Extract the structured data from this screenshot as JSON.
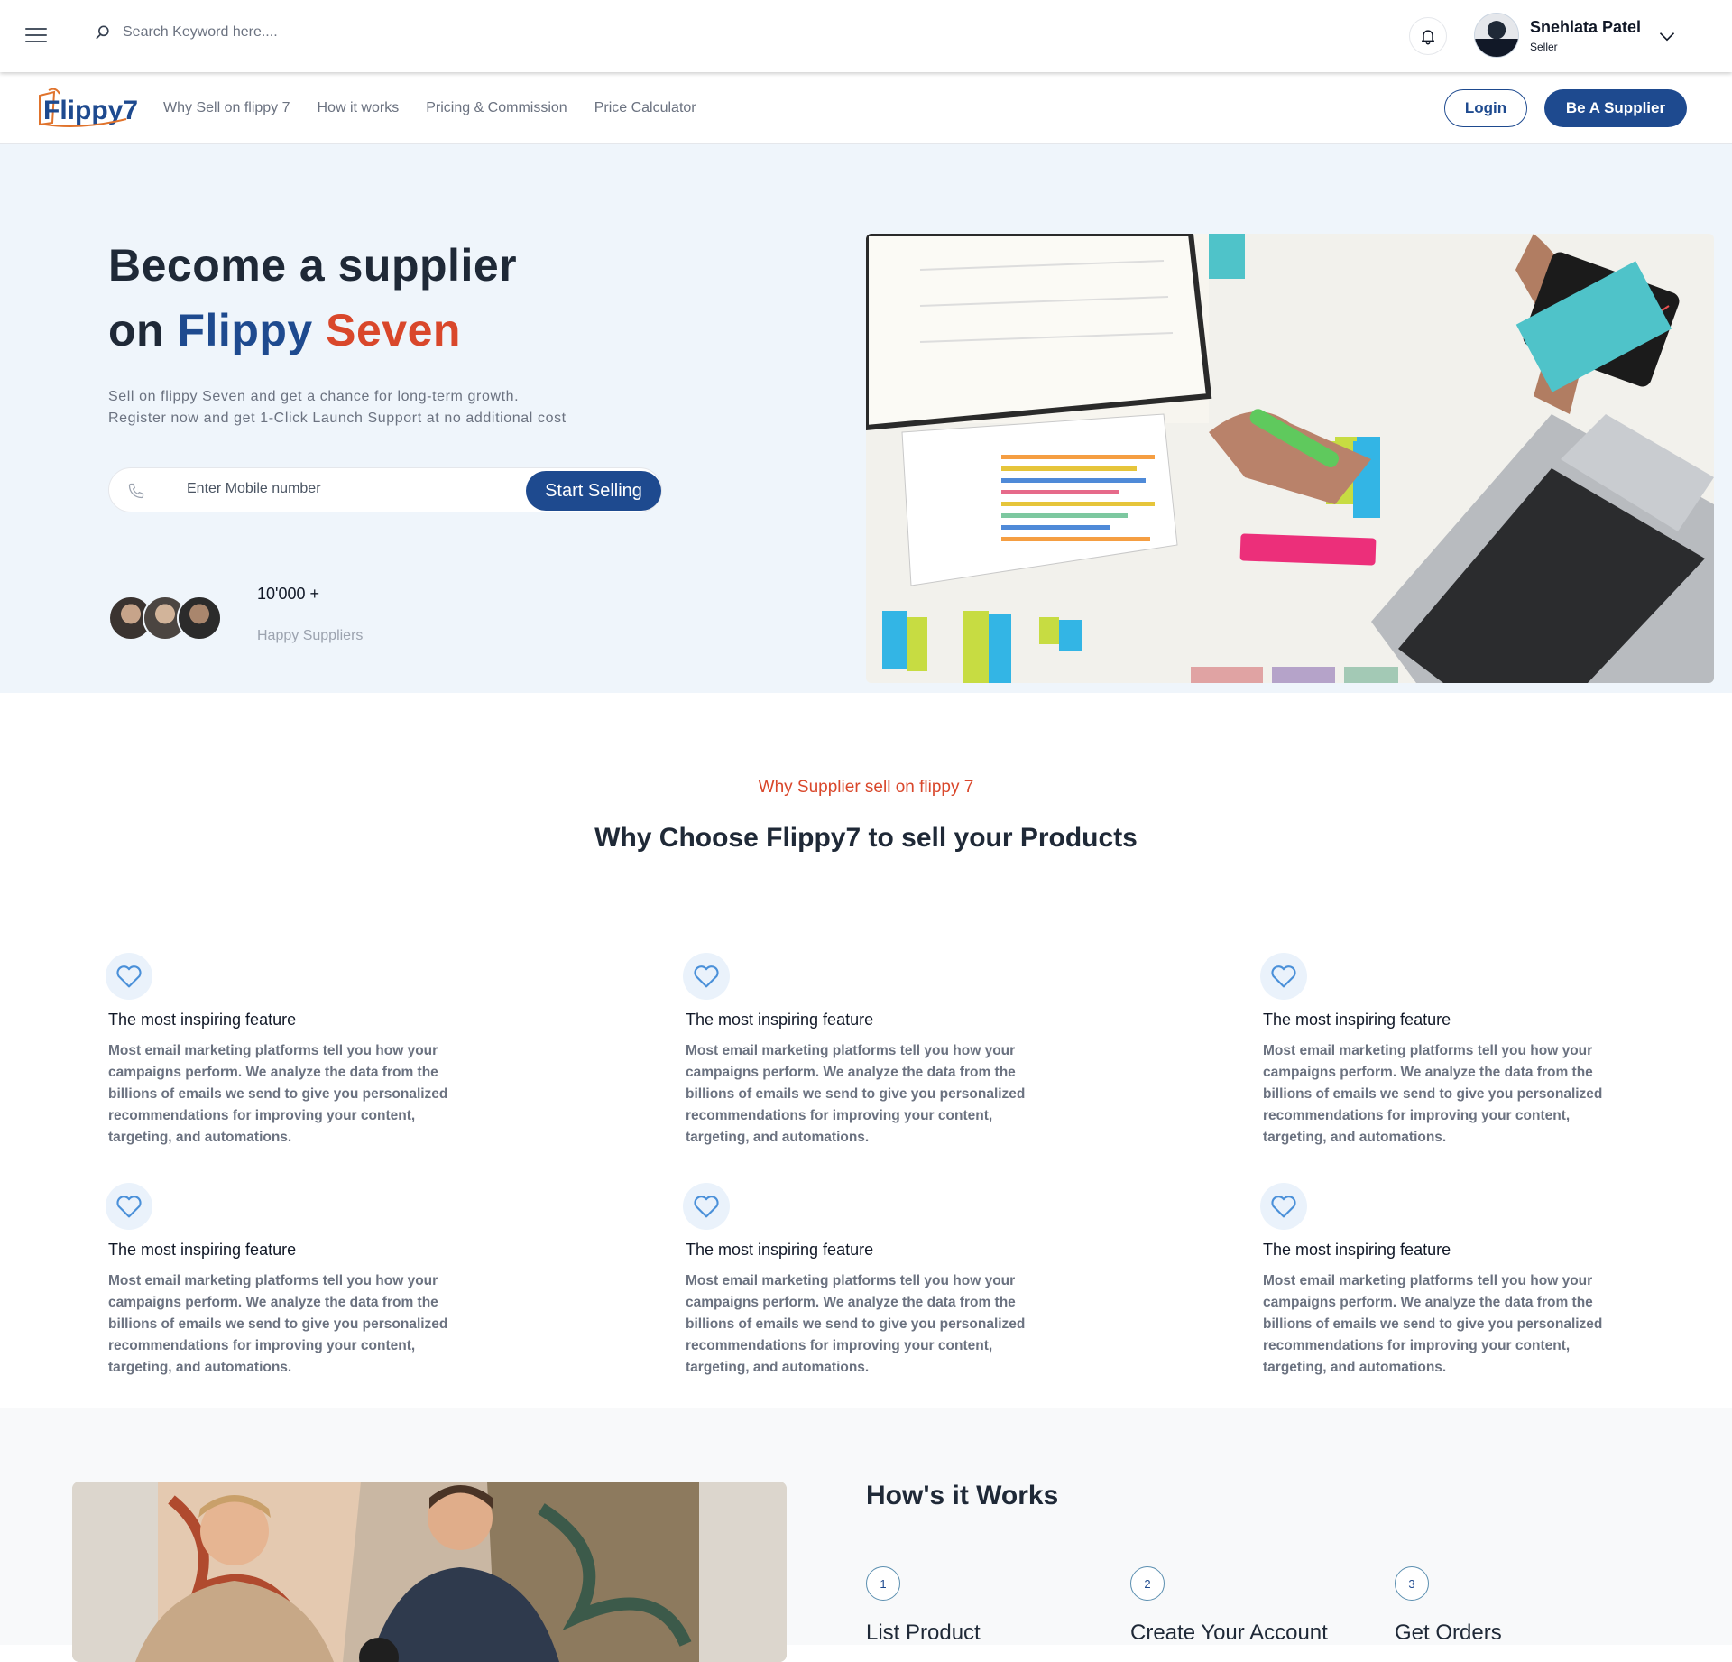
{
  "topbar": {
    "search_placeholder": "Search Keyword here....",
    "user_name": "Snehlata Patel",
    "user_role": "Seller"
  },
  "nav": {
    "brand": "Flippy7",
    "links": [
      "Why Sell on flippy 7",
      "How it works",
      "Pricing & Commission",
      "Price Calculator"
    ],
    "login_label": "Login",
    "supplier_label": "Be A Supplier"
  },
  "hero": {
    "title_line1": "Become a supplier",
    "title_on": "on",
    "title_flippy": "Flippy",
    "title_seven": "Seven",
    "description": "Sell on flippy Seven and get a chance for long-term growth. Register now and get 1-Click Launch Support at no additional cost",
    "mobile_placeholder": "Enter Mobile number",
    "cta_label": "Start Selling",
    "stat_value": "10'000 +",
    "stat_label": "Happy Suppliers"
  },
  "why": {
    "kicker": "Why Supplier sell on flippy 7",
    "heading": "Why Choose Flippy7 to sell your Products",
    "features": [
      {
        "title": "The most inspiring feature",
        "description": "Most email marketing platforms tell you how your campaigns perform. We analyze the data from the billions of emails we send to give you personalized recommendations for improving your content, targeting, and automations."
      },
      {
        "title": "The most inspiring feature",
        "description": "Most email marketing platforms tell you how your campaigns perform. We analyze the data from the billions of emails we send to give you personalized recommendations for improving your content, targeting, and automations."
      },
      {
        "title": "The most inspiring feature",
        "description": "Most email marketing platforms tell you how your campaigns perform. We analyze the data from the billions of emails we send to give you personalized recommendations for improving your content, targeting, and automations."
      },
      {
        "title": "The most inspiring feature",
        "description": "Most email marketing platforms tell you how your campaigns perform. We analyze the data from the billions of emails we send to give you personalized recommendations for improving your content, targeting, and automations."
      },
      {
        "title": "The most inspiring feature",
        "description": "Most email marketing platforms tell you how your campaigns perform. We analyze the data from the billions of emails we send to give you personalized recommendations for improving your content, targeting, and automations."
      },
      {
        "title": "The most inspiring feature",
        "description": "Most email marketing platforms tell you how your campaigns perform. We analyze the data from the billions of emails we send to give you personalized recommendations for improving your content, targeting, and automations."
      }
    ]
  },
  "how": {
    "heading": "How's it Works",
    "steps": [
      {
        "number": "1",
        "label": "List Product"
      },
      {
        "number": "2",
        "label": "Create Your Account"
      },
      {
        "number": "3",
        "label": "Get Orders"
      }
    ]
  },
  "colors": {
    "brand_blue": "#1e4a8f",
    "accent_orange": "#d9472b",
    "hero_bg": "#eff5fb"
  },
  "icons": [
    "menu-icon",
    "search-icon",
    "bell-icon",
    "chevron-down-icon",
    "phone-icon",
    "heart-icon"
  ]
}
